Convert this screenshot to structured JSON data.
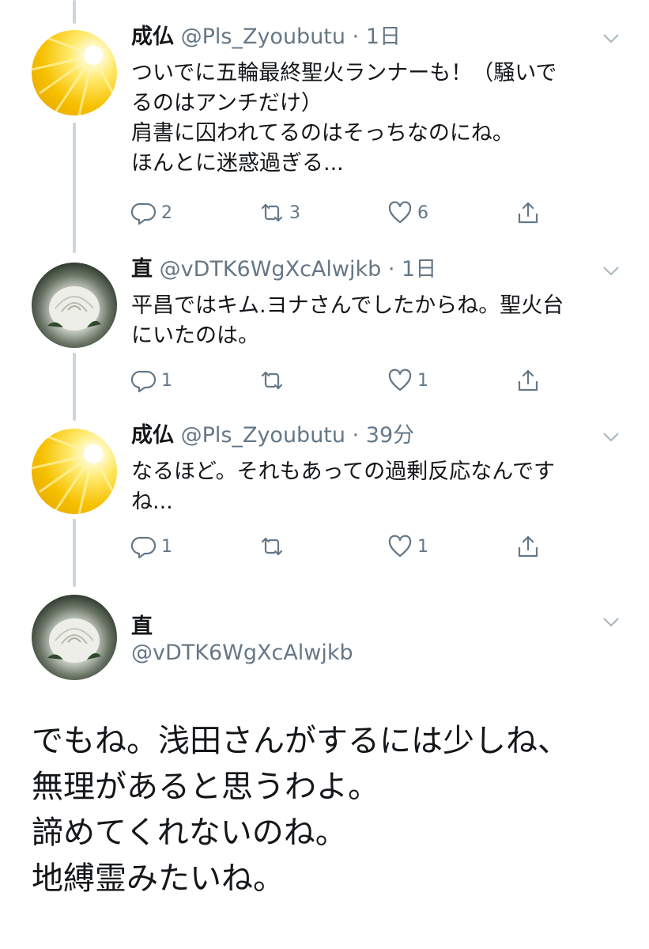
{
  "tweets": [
    {
      "name": "成仏",
      "handle": "@Pls_Zyoubutu",
      "dot": "·",
      "time": "1日",
      "avatar": "sun-avatar",
      "lines": [
        "ついでに五輪最終聖火ランナーも！（騒いで",
        "るのはアンチだけ）",
        "肩書に囚われてるのはそっちなのにね。",
        "ほんとに迷惑過ぎる..."
      ],
      "reply_count": "2",
      "retweet_count": "3",
      "like_count": "6"
    },
    {
      "name": "直",
      "handle": "@vDTK6WgXcAlwjkb",
      "dot": "·",
      "time": "1日",
      "avatar": "white-rose-avatar",
      "lines": [
        "平昌ではキム.ヨナさんでしたからね。聖火台",
        "にいたのは。"
      ],
      "reply_count": "1",
      "retweet_count": "",
      "like_count": "1"
    },
    {
      "name": "成仏",
      "handle": "@Pls_Zyoubutu",
      "dot": "·",
      "time": "39分",
      "avatar": "sun-avatar",
      "lines": [
        "なるほど。それもあっての過剰反応なんです",
        "ね..."
      ],
      "reply_count": "1",
      "retweet_count": "",
      "like_count": "1"
    }
  ],
  "main_tweet": {
    "name": "直",
    "handle": "@vDTK6WgXcAlwjkb",
    "avatar": "white-rose-avatar",
    "lines": [
      "でもね。浅田さんがするには少しね、",
      "無理があると思うわよ。",
      "諦めてくれないのね。",
      "地縛霊みたいね。"
    ]
  },
  "colors": {
    "text": "#14171a",
    "secondary": "#657786",
    "thread_line": "#ccd6dd"
  },
  "icons": [
    "reply-icon",
    "retweet-icon",
    "like-icon",
    "share-icon",
    "chevron-down-icon"
  ]
}
